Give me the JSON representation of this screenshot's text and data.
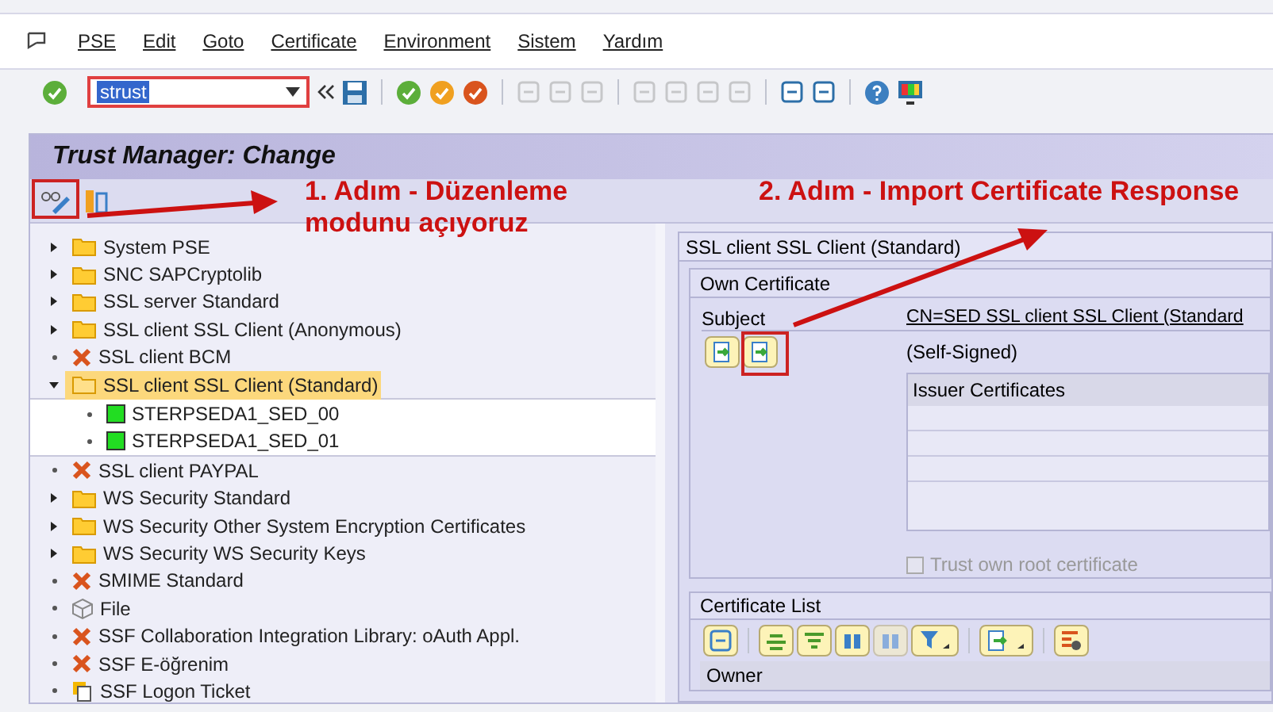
{
  "menu": [
    "PSE",
    "Edit",
    "Goto",
    "Certificate",
    "Environment",
    "Sistem",
    "Yardım"
  ],
  "command_field": {
    "value": "strust"
  },
  "title": "Trust Manager: Change",
  "annotations": [
    {
      "text": "1. Adım - Düzenleme modunu açıyoruz"
    },
    {
      "text": "2. Adım - Import Certificate Response"
    }
  ],
  "tree": [
    {
      "label": "System PSE",
      "kind": "folder",
      "expanded": false,
      "selected": false
    },
    {
      "label": "SNC SAPCryptolib",
      "kind": "folder",
      "expanded": false,
      "selected": false
    },
    {
      "label": "SSL server Standard",
      "kind": "folder",
      "expanded": false,
      "selected": false
    },
    {
      "label": "SSL client SSL Client (Anonymous)",
      "kind": "folder",
      "expanded": false,
      "selected": false
    },
    {
      "label": "SSL client BCM",
      "kind": "error",
      "selected": false
    },
    {
      "label": "SSL client SSL Client (Standard)",
      "kind": "folder",
      "expanded": true,
      "selected": true,
      "children": [
        {
          "label": "STERPSEDA1_SED_00",
          "kind": "server",
          "selected": false
        },
        {
          "label": "STERPSEDA1_SED_01",
          "kind": "server",
          "selected": false
        }
      ]
    },
    {
      "label": "SSL client PAYPAL",
      "kind": "error",
      "selected": false
    },
    {
      "label": "WS Security Standard",
      "kind": "folder",
      "expanded": false,
      "selected": false
    },
    {
      "label": "WS Security Other System Encryption Certificates",
      "kind": "folder",
      "expanded": false,
      "selected": false
    },
    {
      "label": "WS Security WS Security Keys",
      "kind": "folder",
      "expanded": false,
      "selected": false
    },
    {
      "label": "SMIME Standard",
      "kind": "error",
      "selected": false
    },
    {
      "label": "File",
      "kind": "file",
      "selected": false
    },
    {
      "label": "SSF Collaboration Integration Library: oAuth Appl.",
      "kind": "error",
      "selected": false
    },
    {
      "label": "SSF E-öğrenim",
      "kind": "error",
      "selected": false
    },
    {
      "label": "SSF Logon Ticket",
      "kind": "ticket",
      "selected": false
    }
  ],
  "detail": {
    "title": "SSL client SSL Client (Standard)",
    "own_certificate": {
      "title": "Own Certificate",
      "subject_label": "Subject",
      "subject": "CN=SED SSL client SSL Client (Standard",
      "signed": "(Self-Signed)",
      "issuer_header": "Issuer Certificates"
    },
    "trust_checkbox": {
      "label": "Trust own root certificate",
      "checked": false,
      "disabled": true
    },
    "certificate_list": {
      "title": "Certificate List",
      "column_1": "Owner"
    }
  }
}
